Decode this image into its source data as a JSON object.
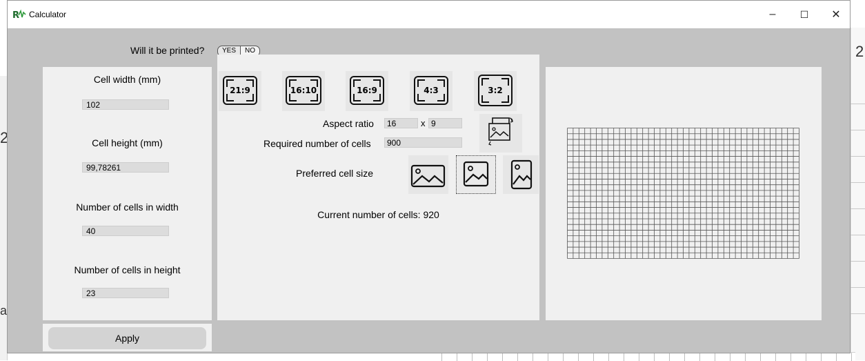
{
  "background": {
    "left_chars": [
      "2",
      "a"
    ],
    "right_char": "2"
  },
  "window": {
    "title": "Calculator",
    "app_icon": "calculator-app-icon",
    "controls": {
      "minimize": "–",
      "maximize": "☐",
      "close": "✕"
    }
  },
  "print": {
    "question": "Will it be printed?",
    "yes": "YES",
    "no": "NO"
  },
  "left": {
    "cell_width_label": "Cell width (mm)",
    "cell_width_value": "102",
    "cell_height_label": "Cell height (mm)",
    "cell_height_value": "99,78261",
    "cells_width_label": "Number of cells in width",
    "cells_width_value": "40",
    "cells_height_label": "Number of cells in height",
    "cells_height_value": "23",
    "apply": "Apply"
  },
  "middle": {
    "ratios": [
      "21:9",
      "16:10",
      "16:9",
      "4:3",
      "3:2"
    ],
    "aspect_label": "Aspect ratio",
    "aspect_w": "16",
    "aspect_x": "x",
    "aspect_h": "9",
    "required_label": "Required number of cells",
    "required_value": "900",
    "preferred_label": "Preferred cell size",
    "preferred_options": [
      "landscape-image-icon",
      "square-image-icon",
      "portrait-image-icon"
    ],
    "preferred_selected": "square-image-icon",
    "current_cells": "Current number of cells: 920"
  },
  "preview": {
    "columns": 40,
    "rows": 23,
    "line_color": "#555555"
  },
  "colors": {
    "window_bg": "#c2c2c2",
    "panel_bg": "#f0f0f0",
    "input_bg": "#dcdcdc"
  }
}
